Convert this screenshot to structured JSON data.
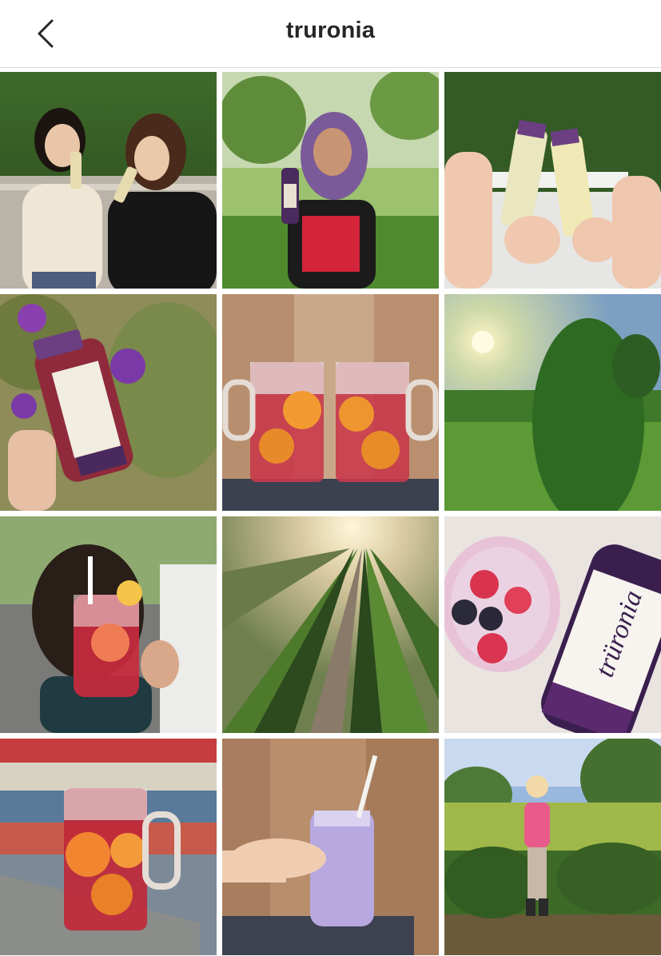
{
  "header": {
    "title": "truronia",
    "back_icon": "chevron-left-icon"
  },
  "colors": {
    "header_border": "#dbdbdb",
    "title_text": "#262626",
    "brand_purple": "#5b2a6e"
  },
  "grid": {
    "columns": 3,
    "posts": [
      {
        "description": "Two women drinking bottled juice"
      },
      {
        "description": "Woman with purple hair holding bottle"
      },
      {
        "description": "Two hands toasting bottles"
      },
      {
        "description": "Hand holding bottle among purple flowers"
      },
      {
        "description": "Two mugs of red drink with orange slices"
      },
      {
        "description": "Sunlit plant in field"
      },
      {
        "description": "Woman holding mason jar drink"
      },
      {
        "description": "Rows of aronia bushes at sunrise"
      },
      {
        "description": "Berry smoothie with bottle"
      },
      {
        "description": "Mug of red drink with orange slices"
      },
      {
        "description": "Hand holding purple smoothie jar"
      },
      {
        "description": "Child standing in aronia field"
      }
    ]
  },
  "product_label": {
    "brand": "trüronia"
  }
}
